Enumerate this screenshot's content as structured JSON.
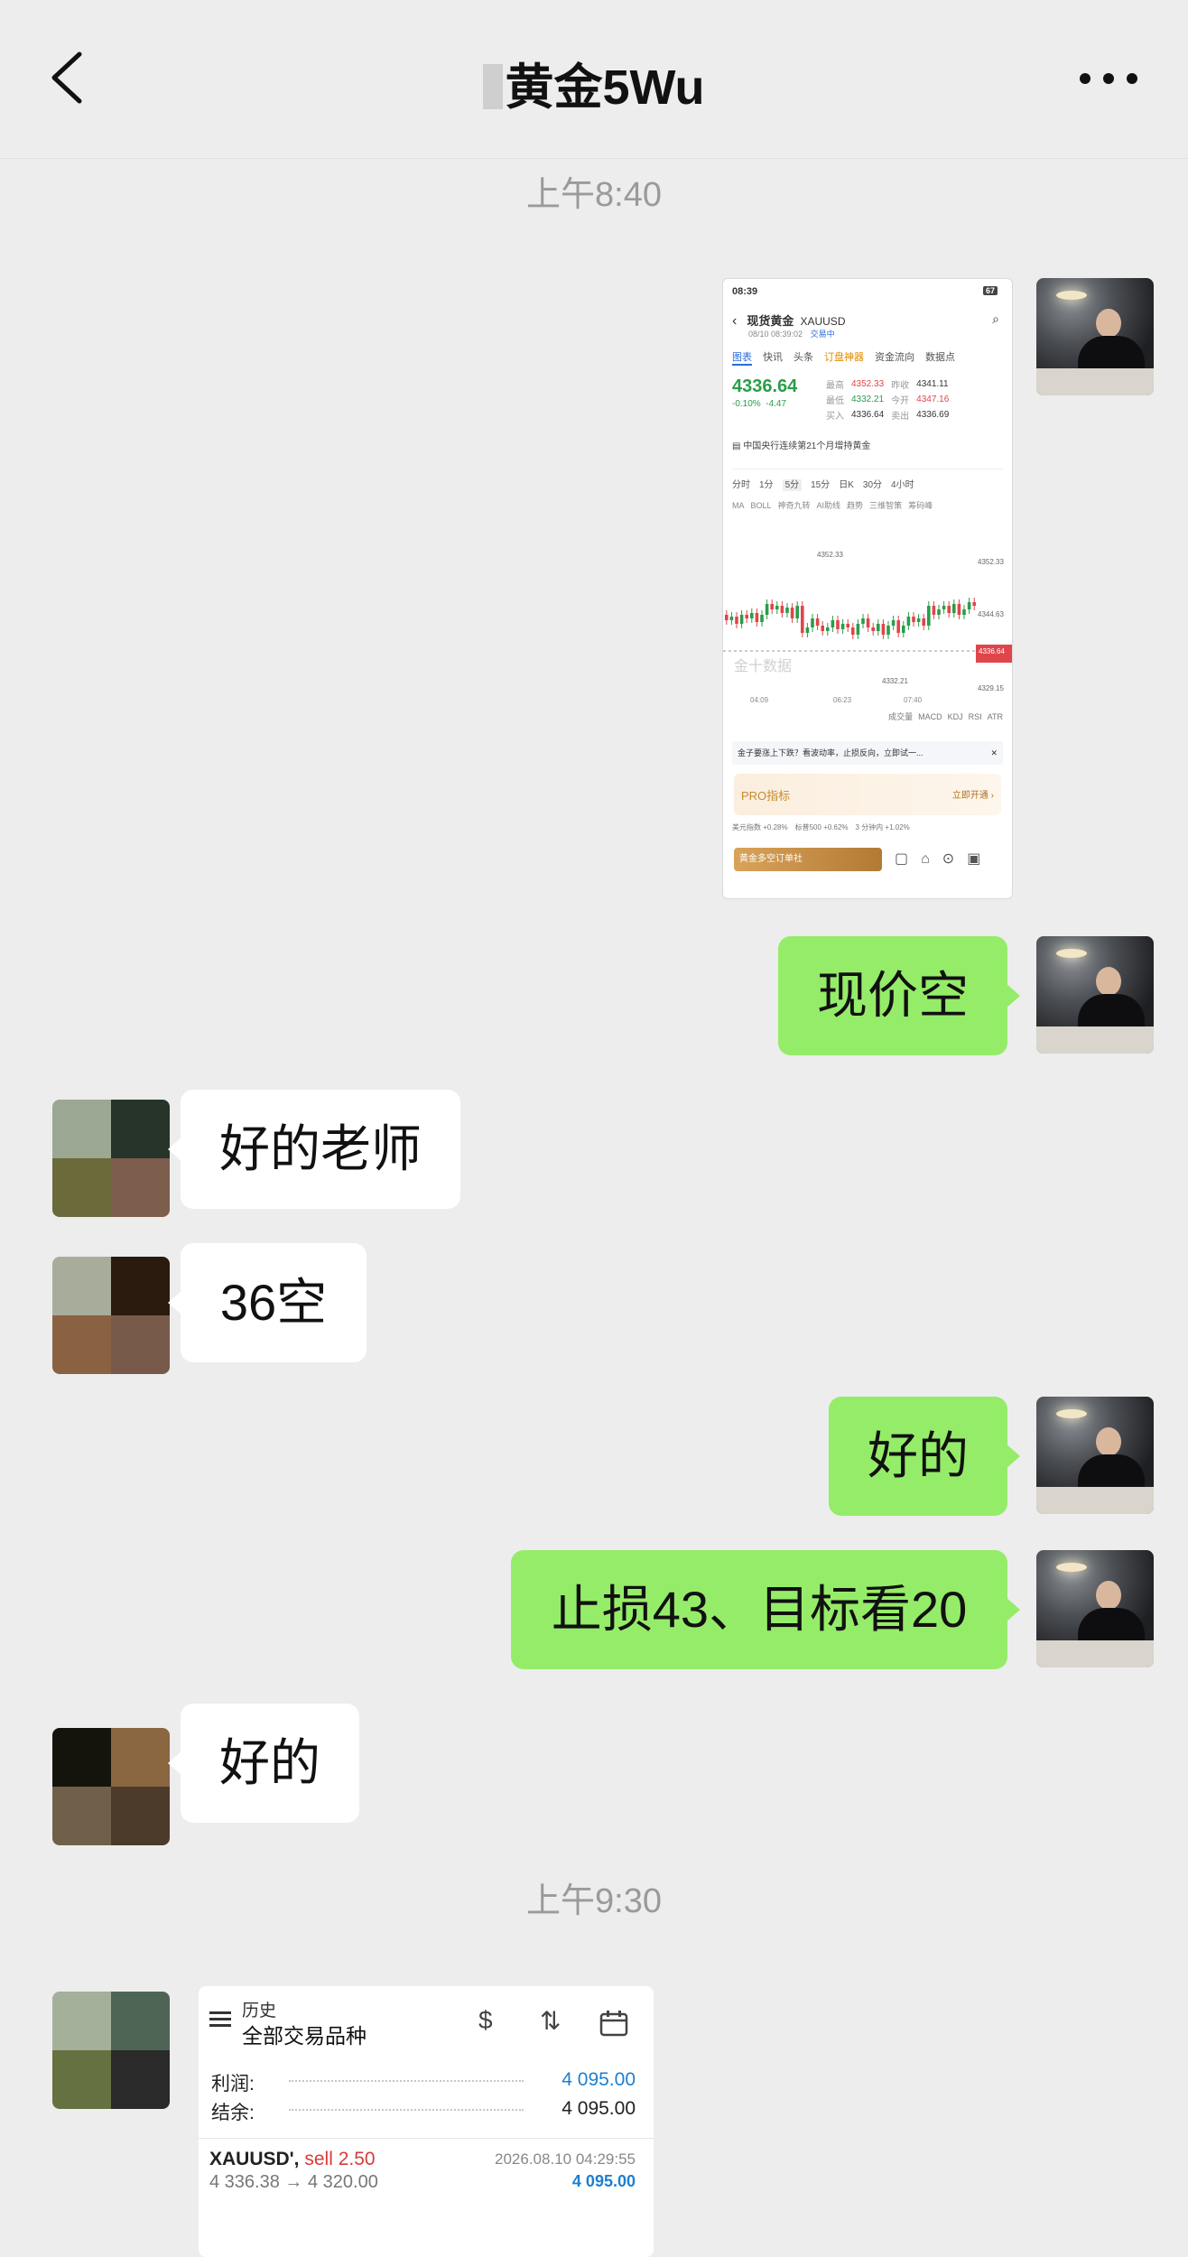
{
  "nav": {
    "title": "黄金5Wu",
    "back_icon": "chevron-left-icon",
    "more_icon": "more-dots-icon"
  },
  "colors": {
    "background": "#ededed",
    "my_bubble": "#95ec69",
    "their_bubble": "#ffffff",
    "timestamp": "#9a9a9a",
    "profit_blue": "#1d7fd1"
  },
  "timestamps": [
    "上午8:40",
    "上午9:30"
  ],
  "messages": [
    {
      "from": "me",
      "type": "image",
      "content": "screenshot-gold-chart"
    },
    {
      "from": "me",
      "type": "text",
      "text": "现价空"
    },
    {
      "from": "other",
      "type": "text",
      "text": "好的老师"
    },
    {
      "from": "other",
      "type": "text",
      "text": "36空"
    },
    {
      "from": "me",
      "type": "text",
      "text": "好的"
    },
    {
      "from": "me",
      "type": "text",
      "text": "止损43、目标看20"
    },
    {
      "from": "other",
      "type": "text",
      "text": "好的"
    },
    {
      "from": "other",
      "type": "image",
      "content": "trade-history-card"
    }
  ],
  "screenshot": {
    "status_time": "08:39",
    "battery": "67",
    "title": "现货黄金",
    "symbol": "XAUUSD",
    "datetime": "08/10 08:39:02",
    "status": "交易中",
    "tabs": [
      "图表",
      "快讯",
      "头条",
      "订盘神器",
      "资金流向",
      "数据点"
    ],
    "price": "4336.64",
    "change": "-0.10%",
    "change_abs": "-4.47",
    "quote": [
      [
        "最高",
        "4352.33",
        "昨收",
        "4341.11"
      ],
      [
        "最低",
        "4332.21",
        "今开",
        "4347.16"
      ],
      [
        "买入",
        "4336.64",
        "卖出",
        "4336.69"
      ]
    ],
    "news": "中国央行连续第21个月增持黄金",
    "periods": [
      "分时",
      "1分",
      "5分",
      "15分",
      "日K",
      "30分",
      "4小时"
    ],
    "indicators": [
      "MA",
      "BOLL",
      "神奇九转",
      "AI助线",
      "趋势",
      "三维智策",
      "筹码峰"
    ],
    "chart_high": "4352.33",
    "chart_low": "4332.21",
    "axis_prices": [
      "4352.33",
      "4344.63",
      "4336.64",
      "4329.15"
    ],
    "axis_times": [
      "04:09",
      "06:23",
      "07:40"
    ],
    "watermark": "金十数据",
    "sub_indicators": [
      "成交量",
      "MACD",
      "KDJ",
      "RSI",
      "ATR"
    ],
    "ai_tip": "金子要涨上下跌？看波动率，止损反向，立即试一...",
    "pro_label": "PRO指标",
    "pro_action": "立即开通 ›",
    "ticker": [
      "美元指数 +0.28%",
      "标普500 +0.62%",
      "3 分钟内 +1.02%"
    ],
    "order_button": "黄金多空订单社"
  },
  "trade": {
    "menu_icon": "hamburger-menu-icon",
    "header_small": "历史",
    "header_big": "全部交易品种",
    "profit_label": "利润:",
    "profit_value": "4 095.00",
    "balance_label": "结余:",
    "balance_value": "4 095.00",
    "symbol": "XAUUSD',",
    "side": "sell 2.50",
    "prices": "4 336.38 → 4 320.00",
    "date": "2026.08.10 04:29:55",
    "row_profit": "4 095.00"
  }
}
